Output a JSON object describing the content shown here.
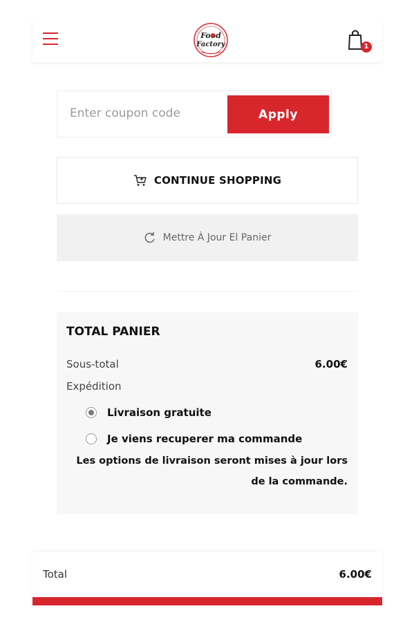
{
  "header": {
    "menu_icon": "hamburger-icon",
    "logo_text": "Food Factory",
    "cart_icon": "shopping-bag-icon",
    "cart_count": "1"
  },
  "coupon": {
    "placeholder": "Enter coupon code",
    "value": "",
    "apply_label": "Apply"
  },
  "actions": {
    "continue_shopping": "CONTINUE SHOPPING",
    "continue_icon": "cart-icon",
    "update_cart": "Mettre À Jour El Panier",
    "update_icon": "refresh-icon"
  },
  "totals": {
    "title": "TOTAL PANIER",
    "subtotal_label": "Sous-total",
    "subtotal_value": "6.00€",
    "shipping_label": "Expédition",
    "shipping_options": [
      {
        "label": "Livraison gratuite",
        "checked": true
      },
      {
        "label": "Je viens recuperer ma commande",
        "checked": false
      }
    ],
    "shipping_note": "Les options de livraison seront mises à jour lors de la commande."
  },
  "footer": {
    "total_label": "Total",
    "total_value": "6.00€"
  },
  "colors": {
    "accent": "#d8262d",
    "panel": "#f7f7f7",
    "update_bg": "#f1f1f1"
  }
}
